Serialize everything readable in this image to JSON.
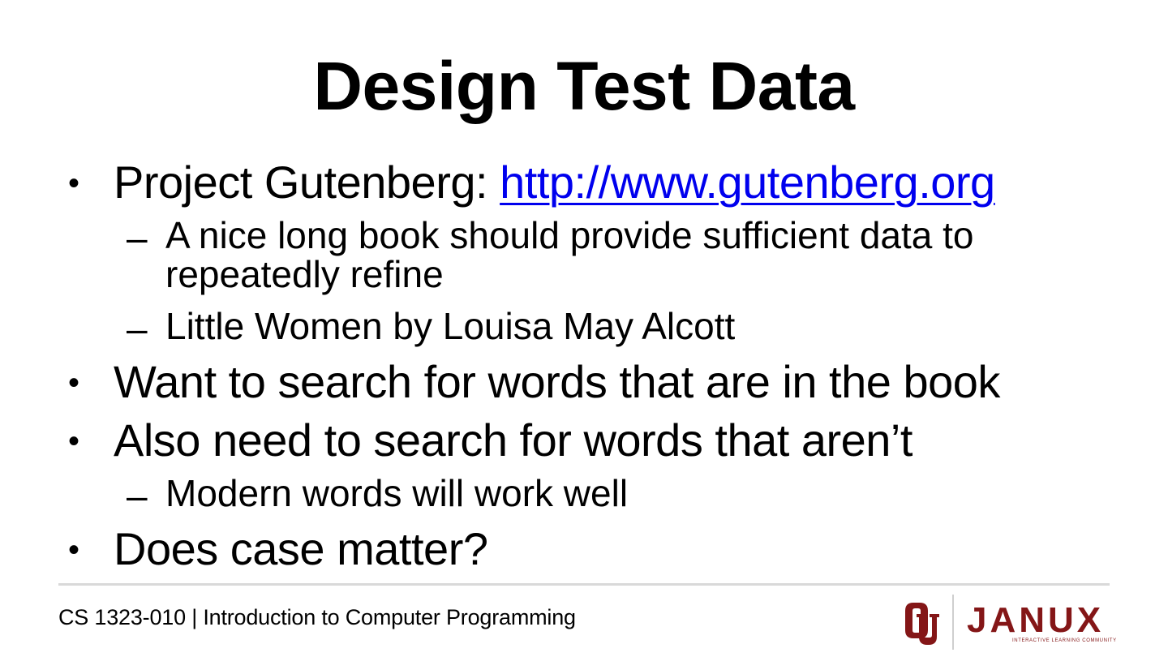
{
  "slide": {
    "title": "Design Test Data",
    "bullets": [
      {
        "prefix": "Project Gutenberg: ",
        "link": "http://www.gutenberg.org",
        "subs": [
          "A nice long book should provide sufficient data to repeatedly refine",
          "Little Women by Louisa May Alcott"
        ]
      },
      {
        "text": "Want to search for words that are in the book"
      },
      {
        "text": "Also need to search for words that aren’t",
        "subs": [
          "Modern words will work well"
        ]
      },
      {
        "text": "Does case matter?"
      }
    ],
    "bullet_glyph": "•",
    "dash_glyph": "–"
  },
  "footer": {
    "course": "CS 1323-010 | Introduction to Computer Programming",
    "logo_word": "JANUX",
    "logo_tagline": "INTERACTIVE LEARNING COMMUNITY",
    "brand_color": "#841617"
  }
}
